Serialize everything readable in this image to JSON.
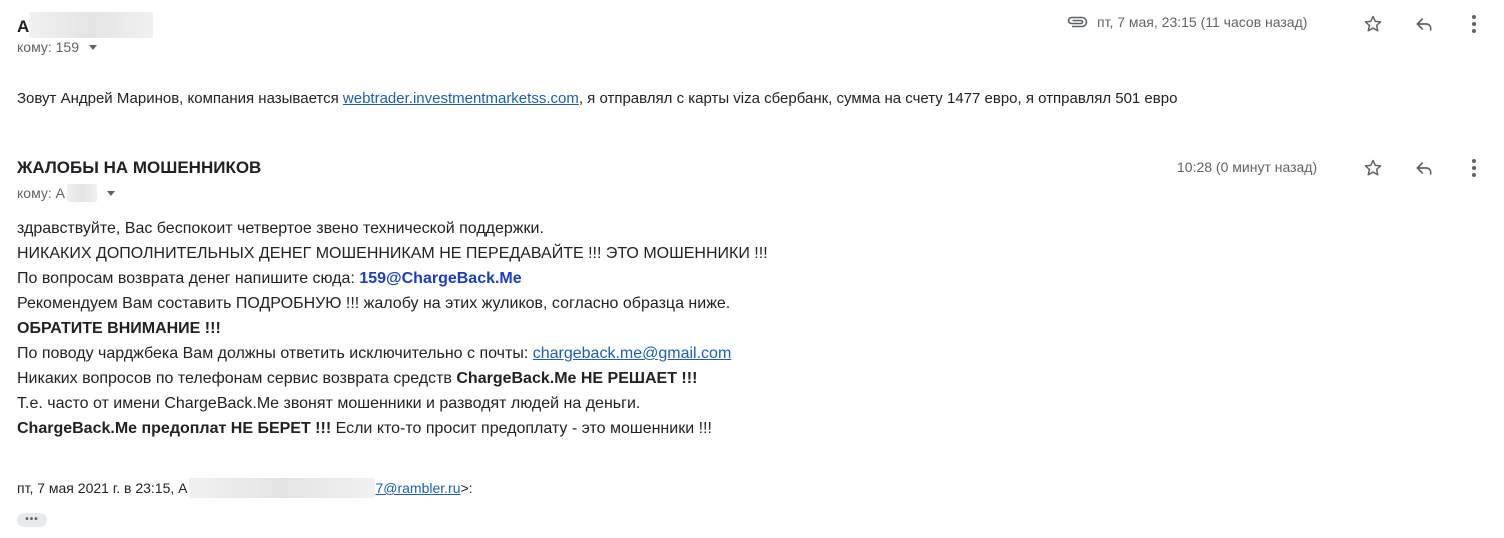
{
  "message1": {
    "sender_initial": "А",
    "to_prefix": "кому:",
    "to_value": "159",
    "date": "пт, 7 мая, 23:15 (11 часов назад)",
    "body": {
      "part1": "Зовут Андрей Маринов, компания называется ",
      "link": "webtrader.investmentmarketss.com",
      "part2": ", я отправлял с карты viza сбербанк, сумма на счету 1477 евро, я отправлял 501 евро"
    }
  },
  "message2": {
    "sender": "ЖАЛОБЫ НА МОШЕННИКОВ",
    "to_prefix": "кому:",
    "to_value": "А",
    "date": "10:28 (0 минут назад)",
    "lines": {
      "l1": "здравствуйте, Вас беспокоит четвертое звено технической поддержки.",
      "l2": "НИКАКИХ ДОПОЛНИТЕЛЬНЫХ ДЕНЕГ МОШЕННИКАМ НЕ ПЕРЕДАВАЙТЕ !!! ЭТО МОШЕННИКИ !!!",
      "l3_prefix": "По вопросам возврата денег напишите сюда: ",
      "l3_email": "159@ChargeBack.Me",
      "l4": "Рекомендуем Вам составить ПОДРОБНУЮ !!! жалобу на этих жуликов, согласно образца ниже.",
      "l5": "ОБРАТИТЕ ВНИМАНИЕ !!!",
      "l6_prefix": "По поводу чарджбека Вам должны ответить исключительно с почты: ",
      "l6_link": "chargeback.me@gmail.com",
      "l7_prefix": "Никаких вопросов по телефонам сервис возврата средств ",
      "l7_bold": "ChargeBack.Me НЕ РЕШАЕТ !!!",
      "l8": "Т.е. часто от имени ChargeBack.Me звонят мошенники и разводят людей на деньги.",
      "l9_bold": "ChargeBack.Me предоплат НЕ БЕРЕТ !!!",
      "l9_rest": " Если кто-то просит предоплату - это мошенники !!!"
    },
    "quote": {
      "prefix": "пт, 7 мая 2021 г. в 23:15, А",
      "email_tail": "7@rambler.ru",
      "suffix": ">:"
    },
    "more_label": "•••"
  }
}
